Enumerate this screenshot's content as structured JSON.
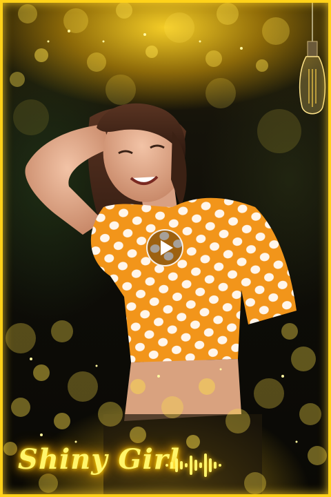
{
  "title": "Shiny Girl",
  "colors": {
    "accent": "#ffd21a",
    "glow": "#fff56a",
    "shirt": "#f39a1c",
    "background": "#0b0a05"
  },
  "icons": {
    "play": "play-icon",
    "bulb": "light-bulb-icon",
    "wave": "audio-waveform-icon"
  }
}
